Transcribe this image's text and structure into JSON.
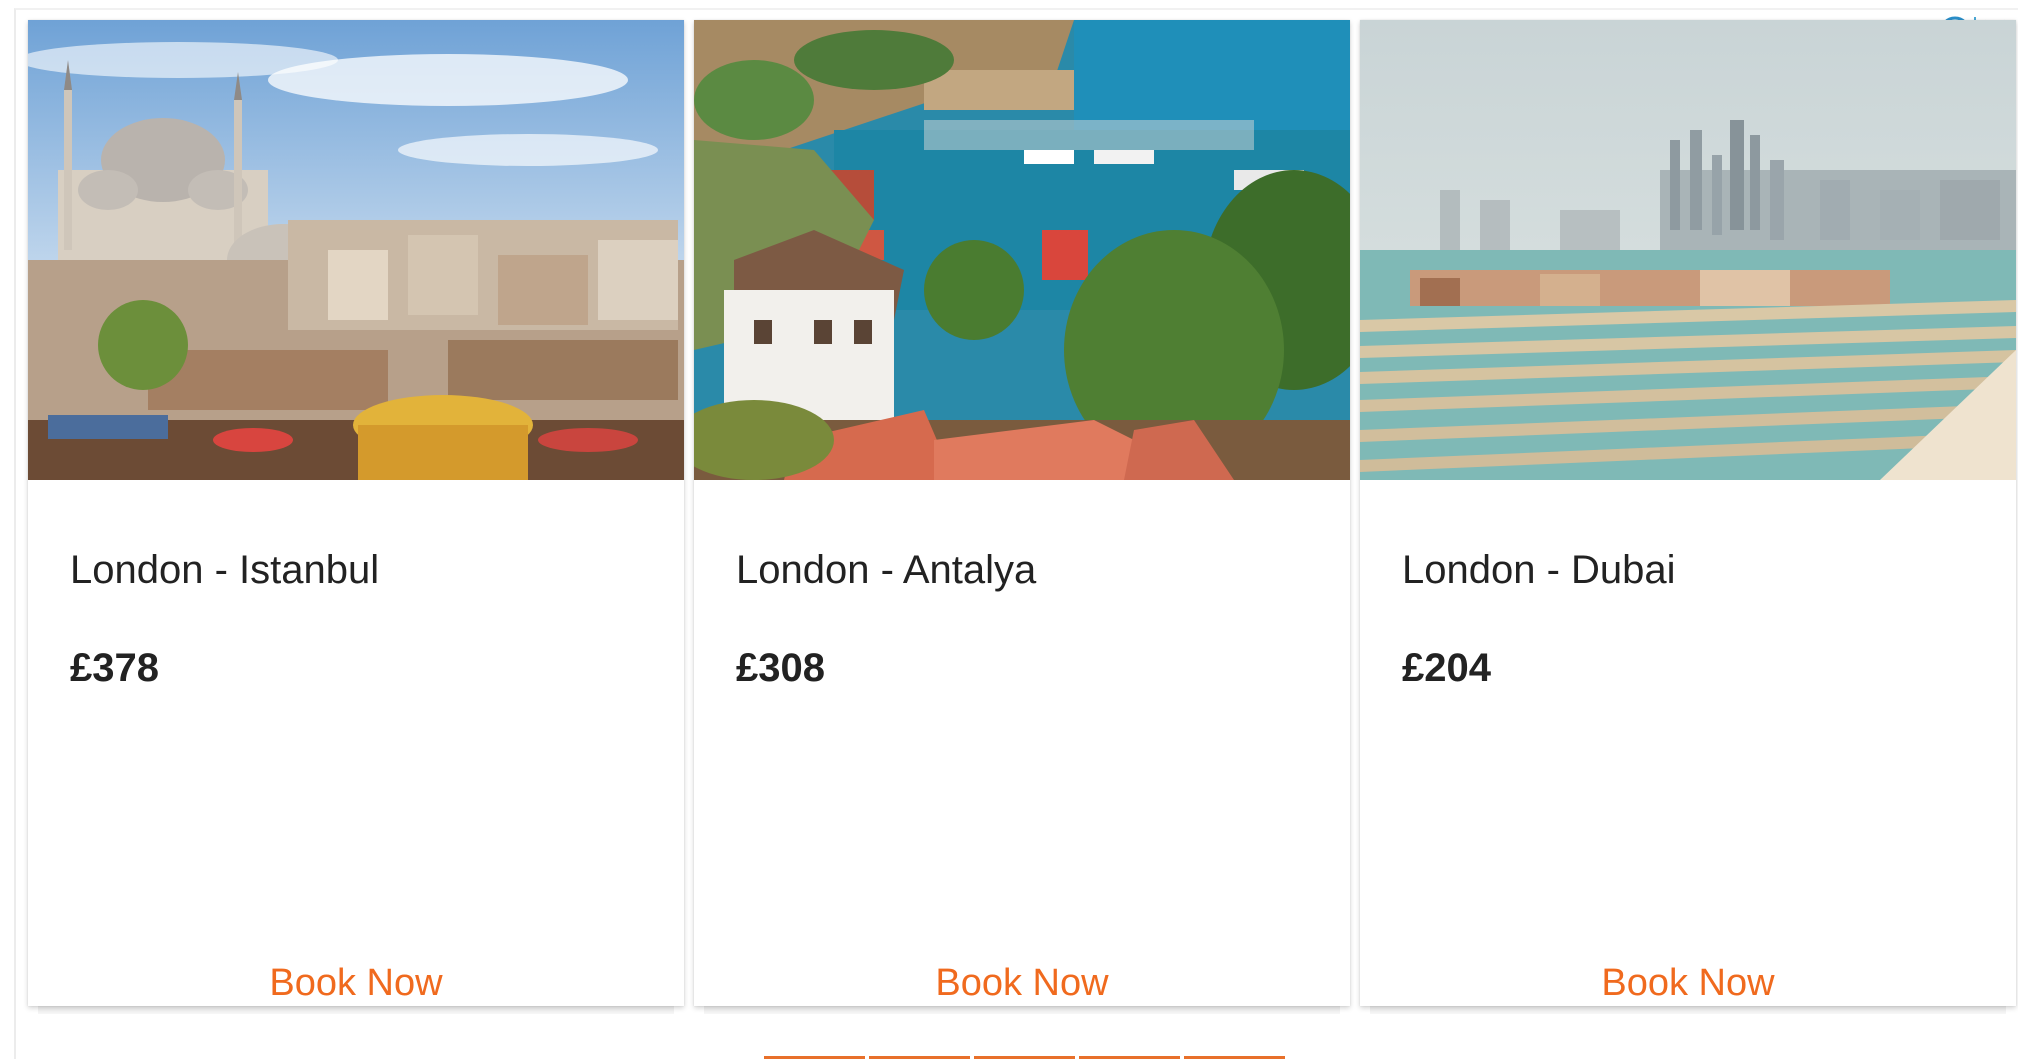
{
  "ad": {
    "adchoices_icon": "info-circle-icon",
    "close_icon": "close-x-icon",
    "accent_color": "#f06a1e",
    "adchoices_color": "#2a8fc9"
  },
  "cards": [
    {
      "route": "London - Istanbul",
      "price": "£378",
      "cta": "Book Now",
      "image": "istanbul-mosque-skyline-photo"
    },
    {
      "route": "London - Antalya",
      "price": "£308",
      "cta": "Book Now",
      "image": "antalya-harbor-photo"
    },
    {
      "route": "London - Dubai",
      "price": "£204",
      "cta": "Book Now",
      "image": "dubai-palm-island-photo"
    }
  ],
  "pager": {
    "count": 5
  }
}
